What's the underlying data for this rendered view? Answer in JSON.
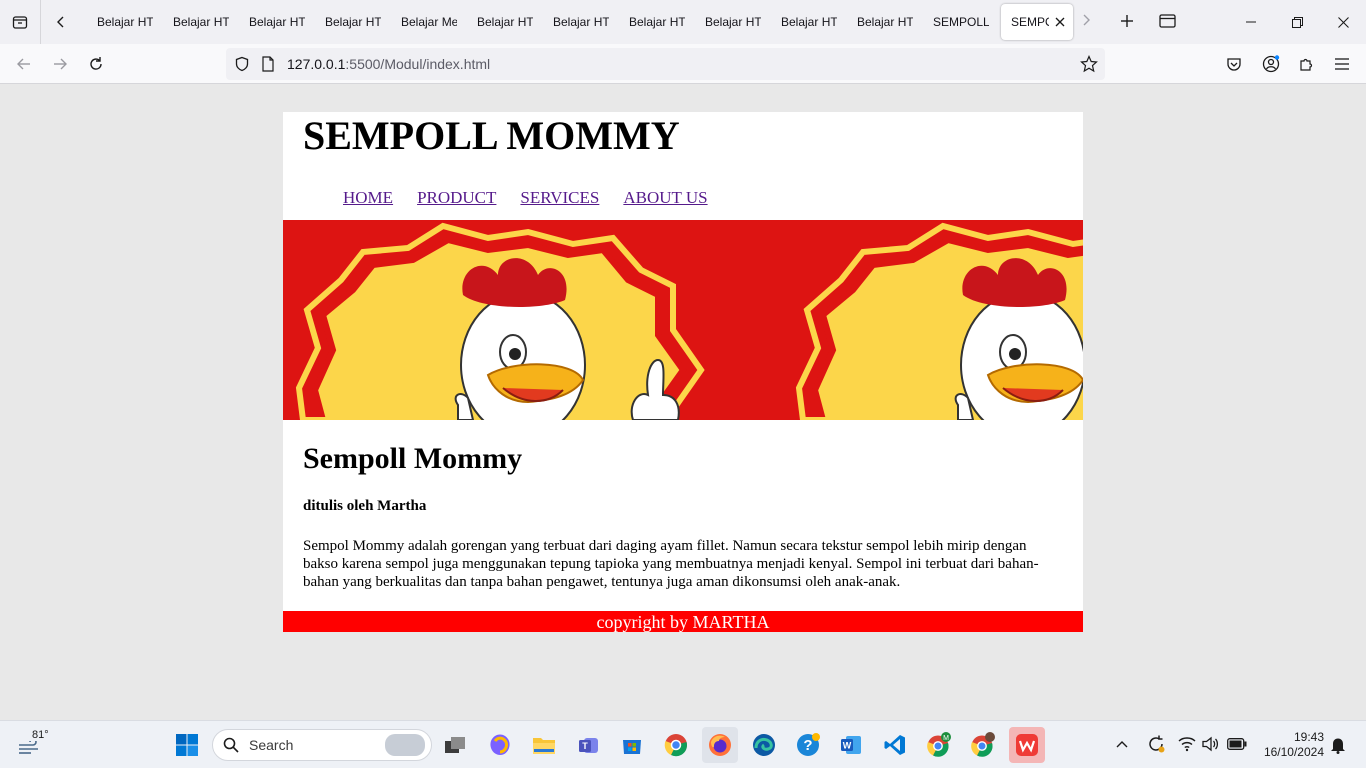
{
  "browser": {
    "tabs": [
      {
        "label": "Belajar HTML"
      },
      {
        "label": "Belajar HTML"
      },
      {
        "label": "Belajar HTML"
      },
      {
        "label": "Belajar HTML"
      },
      {
        "label": "Belajar Me"
      },
      {
        "label": "Belajar HTML"
      },
      {
        "label": "Belajar HTML"
      },
      {
        "label": "Belajar HTML"
      },
      {
        "label": "Belajar HTML"
      },
      {
        "label": "Belajar HTML"
      },
      {
        "label": "Belajar HTML"
      },
      {
        "label": "SEMPOLL"
      }
    ],
    "active_tab": {
      "label": "SEMPOLL MOMMY"
    },
    "url_host": "127.0.0.1",
    "url_rest": ":5500/Modul/index.html"
  },
  "page": {
    "title": "SEMPOLL MOMMY",
    "menu": [
      "HOME",
      "PRODUCT",
      "SERVICES",
      "ABOUT US"
    ],
    "article_title": "Sempoll Mommy",
    "author": "ditulis oleh Martha",
    "body": "Sempol Mommy adalah gorengan yang terbuat dari daging ayam fillet. Namun secara tekstur sempol lebih mirip dengan bakso karena sempol juga menggunakan tepung tapioka yang membuatnya menjadi kenyal. Sempol ini terbuat dari bahan-bahan yang berkualitas dan tanpa bahan pengawet, tentunya juga aman dikonsumsi oleh anak-anak.",
    "footer": "copyright by MARTHA"
  },
  "taskbar": {
    "weather": "81°",
    "search_placeholder": "Search",
    "time": "19:43",
    "date": "16/10/2024"
  },
  "colors": {
    "banner_red": "#dd1412",
    "footer_red": "#ff0000",
    "link_visited": "#551a8b"
  }
}
